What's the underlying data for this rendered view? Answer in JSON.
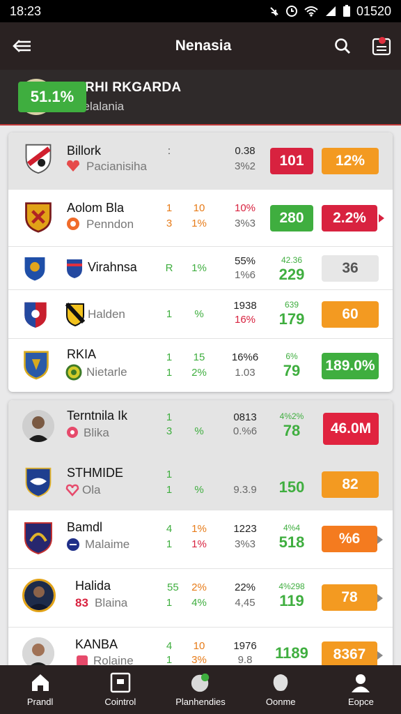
{
  "status": {
    "time": "18:23",
    "right": "01520"
  },
  "header": {
    "title": "Nenasia"
  },
  "featured": {
    "name": "DARHI RKGARDA",
    "sub": "Nelelalania",
    "value": "51.1%"
  },
  "colors": {
    "green": "#3fae3f",
    "red": "#d8223f",
    "orange": "#f39a21",
    "gray": "#e7e7e7",
    "dark": "#2a2222"
  },
  "card1": [
    {
      "team": "Billork",
      "team2": "Pacianisiha",
      "a1": ":",
      "a2": "",
      "b1": "",
      "b2": "",
      "c1": "0.38",
      "c2": "3%2",
      "d1": "",
      "d2": "",
      "p1": "101",
      "p2": "12%"
    },
    {
      "team": "Aolom Bla",
      "team2": "Penndon",
      "a1": "1",
      "a2": "3",
      "b1": "10",
      "b2": "1%",
      "c1": "10%",
      "c2": "3%3",
      "d1": "",
      "d2": "",
      "p1": "280",
      "p2": "2.2%"
    },
    {
      "team": "Virahnsa",
      "team2": "",
      "a1": "R",
      "a2": "",
      "b1": "1%",
      "b2": "",
      "c1": "55%",
      "c2": "1%6",
      "d1": "42.36",
      "d2": "229",
      "p1": "",
      "p2": "36"
    },
    {
      "team": "",
      "team2": "Halden",
      "a1": "1",
      "a2": "",
      "b1": "%",
      "b2": "",
      "c1": "1938",
      "c2": "16%",
      "d1": "639",
      "d2": "179",
      "p1": "",
      "p2": "60"
    },
    {
      "team": "RKIA",
      "team2": "Nietarle",
      "a1": "1",
      "a2": "1",
      "b1": "15",
      "b2": "2%",
      "c1": "16%6",
      "c2": "1.03",
      "d1": "6%",
      "d2": "79",
      "p1": "",
      "p2": "189.0%"
    }
  ],
  "card2": [
    {
      "team": "Terntnila Ik",
      "team2": "Blika",
      "a1": "1",
      "a2": "3",
      "b1": "",
      "b2": "%",
      "c1": "0813",
      "c2": "0.%6",
      "d1": "4%2%",
      "d2": "78",
      "p": "46.0M"
    },
    {
      "team": "STHMIDE",
      "team2": "Ola",
      "a1": "1",
      "a2": "1",
      "b1": "",
      "b2": "%",
      "c1": "",
      "c2": "9.3.9",
      "d1": "",
      "d2": "150",
      "p": "82"
    },
    {
      "team": "Bamdl",
      "team2": "Malaime",
      "a1": "4",
      "a2": "1",
      "b1": "1%",
      "b2": "1%",
      "c1": "1223",
      "c2": "3%3",
      "d1": "4%4",
      "d2": "518",
      "p": "%6"
    },
    {
      "team": "Halida",
      "team2": "Blaina",
      "team2_prefix": "83",
      "a1": "55",
      "a2": "1",
      "b1": "2%",
      "b2": "4%",
      "c1": "22%",
      "c2": "4,45",
      "d1": "4%298",
      "d2": "119",
      "p": "78"
    },
    {
      "team": "KANBA",
      "team2": "Rolaine",
      "a1": "4",
      "a2": "1",
      "b1": "10",
      "b2": "3%",
      "c1": "1976",
      "c2": "9.8",
      "d1": "",
      "d2": "1189",
      "p": "8367"
    }
  ],
  "nav": [
    {
      "label": "Prandl"
    },
    {
      "label": "Cointrol"
    },
    {
      "label": "Planhendies"
    },
    {
      "label": "Oonme"
    },
    {
      "label": "Eopce"
    }
  ]
}
